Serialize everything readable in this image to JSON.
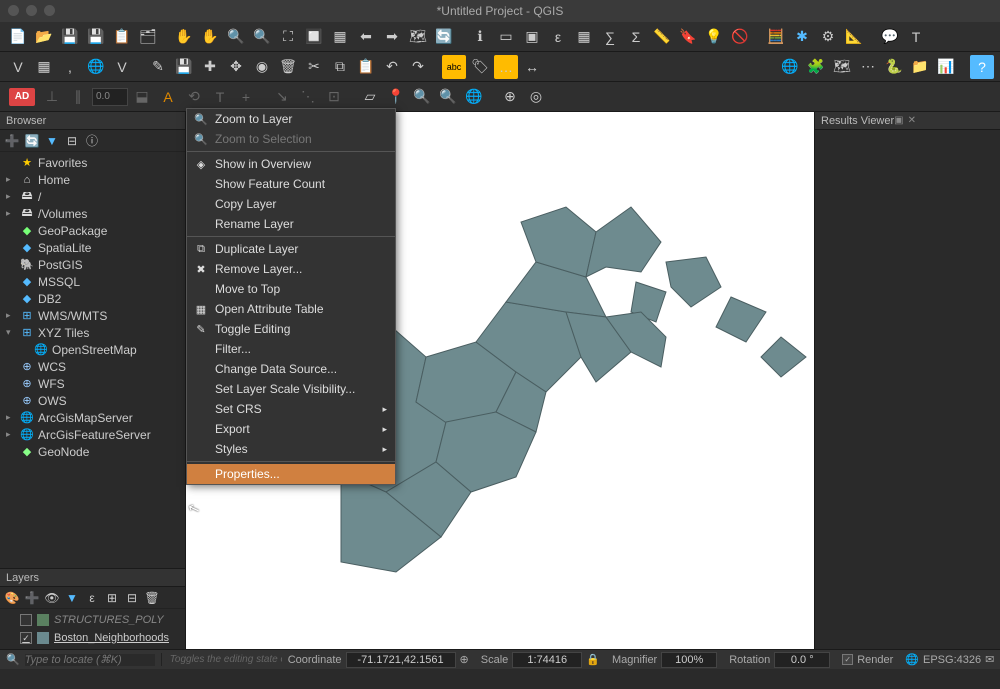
{
  "title": "*Untitled Project - QGIS",
  "toolbar3": {
    "ad": "AD",
    "dist": "0.0"
  },
  "browser": {
    "title": "Browser",
    "items": [
      {
        "icon": "★",
        "cls": "star",
        "label": "Favorites",
        "exp": ""
      },
      {
        "icon": "⌂",
        "cls": "home",
        "label": "Home",
        "exp": "▸"
      },
      {
        "icon": "🖴",
        "cls": "folder",
        "label": "/",
        "exp": "▸"
      },
      {
        "icon": "🖴",
        "cls": "folder",
        "label": "/Volumes",
        "exp": "▸"
      },
      {
        "icon": "◆",
        "cls": "dbg",
        "label": "GeoPackage",
        "exp": ""
      },
      {
        "icon": "◆",
        "cls": "db",
        "label": "SpatiaLite",
        "exp": ""
      },
      {
        "icon": "🐘",
        "cls": "db",
        "label": "PostGIS",
        "exp": ""
      },
      {
        "icon": "◆",
        "cls": "db",
        "label": "MSSQL",
        "exp": ""
      },
      {
        "icon": "◆",
        "cls": "db",
        "label": "DB2",
        "exp": ""
      },
      {
        "icon": "⊞",
        "cls": "xyz",
        "label": "WMS/WMTS",
        "exp": "▸"
      },
      {
        "icon": "⊞",
        "cls": "xyz",
        "label": "XYZ Tiles",
        "exp": "▾"
      },
      {
        "icon": "🌐",
        "cls": "globe",
        "label": "OpenStreetMap",
        "exp": "",
        "lvl": 2
      },
      {
        "icon": "⊕",
        "cls": "globe",
        "label": "WCS",
        "exp": ""
      },
      {
        "icon": "⊕",
        "cls": "globe",
        "label": "WFS",
        "exp": ""
      },
      {
        "icon": "⊕",
        "cls": "globe",
        "label": "OWS",
        "exp": ""
      },
      {
        "icon": "🌐",
        "cls": "globe",
        "label": "ArcGisMapServer",
        "exp": "▸"
      },
      {
        "icon": "🌐",
        "cls": "globe",
        "label": "ArcGisFeatureServer",
        "exp": "▸"
      },
      {
        "icon": "◆",
        "cls": "geo",
        "label": "GeoNode",
        "exp": ""
      }
    ]
  },
  "layers": {
    "title": "Layers",
    "items": [
      {
        "checked": false,
        "swatch": "g",
        "label": "STRUCTURES_POLY",
        "cls": "struct"
      },
      {
        "checked": true,
        "swatch": "b",
        "label": "Boston_Neighborhoods",
        "cls": "sel"
      }
    ]
  },
  "results": {
    "title": "Results Viewer"
  },
  "ctx": [
    {
      "t": "i",
      "icon": "🔍",
      "label": "Zoom to Layer"
    },
    {
      "t": "i",
      "icon": "🔍",
      "label": "Zoom to Selection",
      "dis": true
    },
    {
      "t": "s"
    },
    {
      "t": "i",
      "icon": "◈",
      "label": "Show in Overview"
    },
    {
      "t": "i",
      "icon": "",
      "label": "Show Feature Count"
    },
    {
      "t": "i",
      "icon": "",
      "label": "Copy Layer"
    },
    {
      "t": "i",
      "icon": "",
      "label": "Rename Layer"
    },
    {
      "t": "s"
    },
    {
      "t": "i",
      "icon": "⧉",
      "label": "Duplicate Layer"
    },
    {
      "t": "i",
      "icon": "✖",
      "label": "Remove Layer..."
    },
    {
      "t": "i",
      "icon": "",
      "label": "Move to Top"
    },
    {
      "t": "i",
      "icon": "▦",
      "label": "Open Attribute Table"
    },
    {
      "t": "i",
      "icon": "✎",
      "label": "Toggle Editing"
    },
    {
      "t": "i",
      "icon": "",
      "label": "Filter..."
    },
    {
      "t": "i",
      "icon": "",
      "label": "Change Data Source..."
    },
    {
      "t": "i",
      "icon": "",
      "label": "Set Layer Scale Visibility..."
    },
    {
      "t": "i",
      "icon": "",
      "label": "Set CRS",
      "sub": true
    },
    {
      "t": "i",
      "icon": "",
      "label": "Export",
      "sub": true
    },
    {
      "t": "i",
      "icon": "",
      "label": "Styles",
      "sub": true
    },
    {
      "t": "s"
    },
    {
      "t": "i",
      "icon": "",
      "label": "Properties...",
      "hl": true
    }
  ],
  "footer": {
    "locate_ph": "Type to locate (⌘K)",
    "hint": "Toggles the editing state of",
    "coord_lbl": "Coordinate",
    "coord_val": "-71.1721,42.1561",
    "scale_lbl": "Scale",
    "scale_val": "1:74416",
    "mag_lbl": "Magnifier",
    "mag_val": "100%",
    "rot_lbl": "Rotation",
    "rot_val": "0.0 °",
    "render": "Render",
    "epsg": "EPSG:4326"
  }
}
